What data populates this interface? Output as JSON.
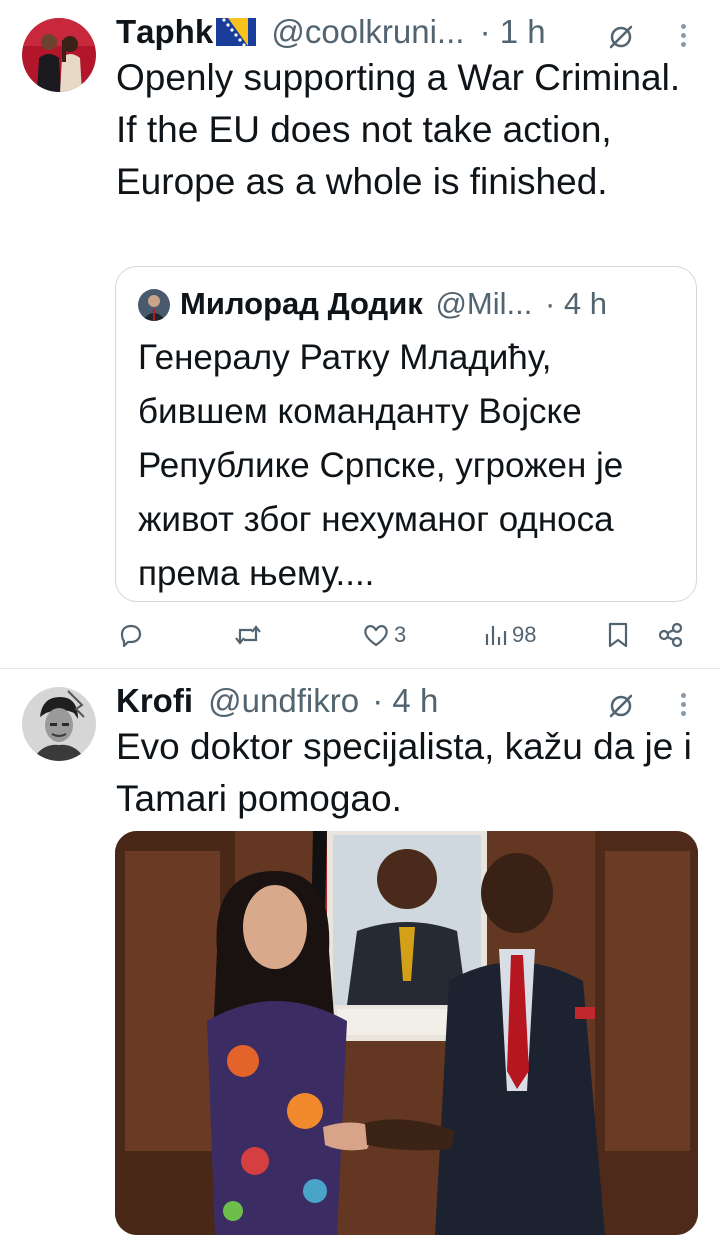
{
  "tweet1": {
    "name": "Tаphk",
    "flag": "bosnia-herzegovina-flag-emoji",
    "handle": "@coolkruni...",
    "dot": "·",
    "time": "1 h",
    "text": "Openly supporting a War Criminal. If the EU does not take action, Europe as a whole is finished.",
    "quote": {
      "name": "Милорад Додик",
      "handle": "@Mil...",
      "dot": "·",
      "time": "4 h",
      "text": "Генералу Ратку Младићу, бившем команданту Војске Републике Српске, угрожен је живот због нехуманог односа према њему...."
    },
    "actions": {
      "replies": "",
      "reposts": "",
      "likes": "3",
      "views": "98"
    }
  },
  "tweet2": {
    "name": "Krofi",
    "handle": "@undfikro",
    "dot": "·",
    "time": "4 h",
    "text": "Evo doktor specijalista, kažu da je i Tamari pomogao."
  },
  "colors": {
    "text": "#0f1419",
    "secondary": "#536471",
    "border": "#cfd9de"
  }
}
